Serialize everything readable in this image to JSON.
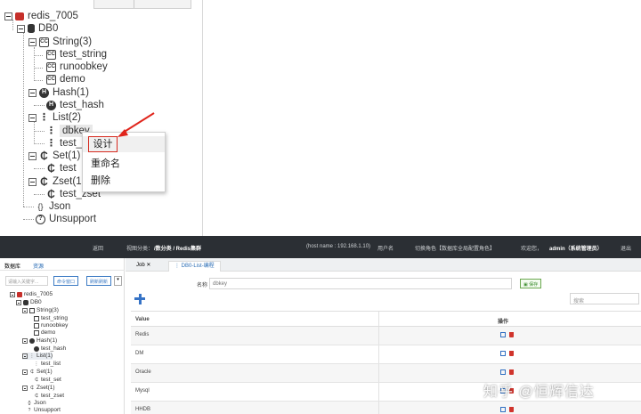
{
  "zoom_tree": {
    "root": "redis_7005",
    "db": "DB0",
    "string_group": "String(3)",
    "string_items": [
      "test_string",
      "runoobkey",
      "demo"
    ],
    "hash_group": "Hash(1)",
    "hash_items": [
      "test_hash"
    ],
    "list_group": "List(2)",
    "list_items": [
      "dbkey",
      "test_"
    ],
    "set_group": "Set(1)",
    "set_items": [
      "test"
    ],
    "zset_group": "Zset(1",
    "zset_items": [
      "test_zset"
    ],
    "json": "Json",
    "unsupport": "Unsupport"
  },
  "context_menu": {
    "design": "设计",
    "rename": "重命名",
    "delete": "删除"
  },
  "app": {
    "topbar": {
      "back": "返回",
      "location_prefix": "视图分类：",
      "location": "/数分类 / Redis集群",
      "host": "(host name : 192.168.1.10)",
      "user_acct": "用户名",
      "switch_role": "切换角色【数据库全局配置角色】",
      "welcome_prefix": "欢迎您，",
      "user": "admin（系统管理员）",
      "exit": "退出"
    },
    "sidebar": {
      "tab_db": "数据库",
      "tab_tree": "资源",
      "search_placeholder": "请输入关键字...",
      "btn_new": "命令窗口",
      "btn_refresh": "刷新刷新",
      "more": "▾"
    },
    "small_tree": {
      "root": "redis_7005",
      "db": "DB0",
      "string_group": "String(3)",
      "string_items": [
        "test_string",
        "runoobkey",
        "demo"
      ],
      "hash_group": "Hash(1)",
      "hash_items": [
        "test_hash"
      ],
      "list_group": "List(1)",
      "list_items": [
        "test_list"
      ],
      "set_group": "Set(1)",
      "set_items": [
        "test_set"
      ],
      "zset_group": "Zset(1)",
      "zset_items": [
        "test_zset"
      ],
      "json": "Json",
      "unsupport": "Unsupport"
    },
    "tabs": [
      {
        "label": "Job"
      },
      {
        "label": "DB0-List-编程"
      }
    ],
    "form": {
      "name_label": "名称",
      "name_value": "dbkey",
      "save_label": "保存",
      "filter_placeholder": "搜索"
    },
    "table": {
      "col_value": "Value",
      "col_ops": "操作",
      "rows": [
        "Redis",
        "DM",
        "Oracle",
        "Mysql",
        "HHDB"
      ]
    }
  },
  "watermark": "知乎 @恒辉信达",
  "colors": {
    "highlight_red": "#d62a1f",
    "accent_blue": "#3673c6",
    "topbar_bg": "#2b2f34",
    "redis_red": "#c6302b"
  }
}
